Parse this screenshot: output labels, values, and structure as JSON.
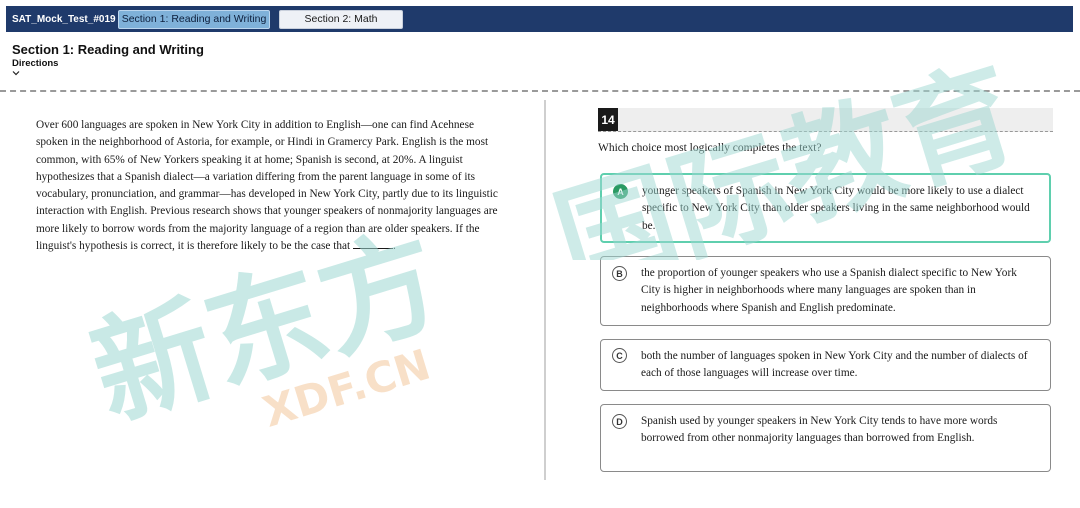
{
  "header": {
    "test_name": "SAT_Mock_Test_#019",
    "tabs": [
      {
        "label": "Section 1: Reading and Writing",
        "active": true
      },
      {
        "label": "Section 2: Math",
        "active": false
      }
    ]
  },
  "section": {
    "title": "Section 1: Reading and Writing",
    "directions_label": "Directions"
  },
  "passage": {
    "text": "Over 600 languages are spoken in New York City in addition to English—one can find Acehnese spoken in the neighborhood of Astoria, for example, or Hindi in Gramercy Park. English is the most common, with 65% of New Yorkers speaking it at home; Spanish is second, at 20%. A linguist hypothesizes that a Spanish dialect—a variation differing from the parent language in some of its vocabulary, pronunciation, and grammar—has developed in New York City, partly due to its linguistic interaction with English. Previous research shows that younger speakers of nonmajority languages are more likely to borrow words from the majority language of a region than are older speakers. If the linguist's hypothesis is correct, it is therefore likely to be the case that"
  },
  "question": {
    "number": "14",
    "stem": "Which choice most logically completes the text?",
    "choices": [
      {
        "letter": "A",
        "text": "younger speakers of Spanish in New York City would be more likely to use a dialect specific to New York City than older speakers living in the same neighborhood would be.",
        "selected": true
      },
      {
        "letter": "B",
        "text": "the proportion of younger speakers who use a Spanish dialect specific to New York City is higher in neighborhoods where many languages are spoken than in neighborhoods where Spanish and English predominate.",
        "selected": false
      },
      {
        "letter": "C",
        "text": "both the number of languages spoken in New York City and the number of dialects of each of those languages will increase over time.",
        "selected": false
      },
      {
        "letter": "D",
        "text": "Spanish used by younger speakers in New York City tends to have more words borrowed from other nonmajority languages than borrowed from English.",
        "selected": false
      }
    ]
  },
  "watermark": {
    "left_text": "新东方",
    "left_sub": "XDF.CN",
    "right_text": "国际教育"
  },
  "colors": {
    "topbar": "#1f3a6b",
    "active_tab": "#7fb1d9",
    "selected_border": "#5fcfae",
    "selected_badge": "#2a9a63"
  }
}
